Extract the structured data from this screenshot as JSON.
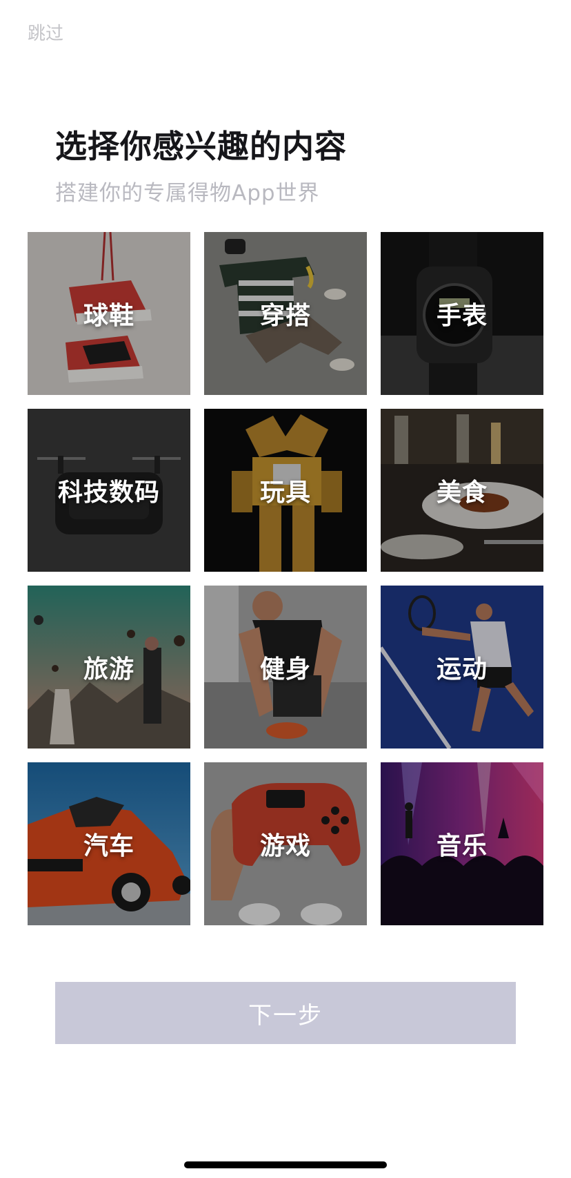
{
  "header": {
    "skip_label": "跳过",
    "title": "选择你感兴趣的内容",
    "subtitle": "搭建你的专属得物App世界"
  },
  "categories": [
    {
      "label": "球鞋",
      "icon": "sneakers-photo"
    },
    {
      "label": "穿搭",
      "icon": "outfit-photo"
    },
    {
      "label": "手表",
      "icon": "watch-photo"
    },
    {
      "label": "科技数码",
      "icon": "drone-photo"
    },
    {
      "label": "玩具",
      "icon": "mecha-figure-photo"
    },
    {
      "label": "美食",
      "icon": "dinner-plate-photo"
    },
    {
      "label": "旅游",
      "icon": "balloon-travel-photo"
    },
    {
      "label": "健身",
      "icon": "athlete-lacing-shoes-photo"
    },
    {
      "label": "运动",
      "icon": "tennis-player-photo"
    },
    {
      "label": "汽车",
      "icon": "sports-car-photo"
    },
    {
      "label": "游戏",
      "icon": "game-controller-photo"
    },
    {
      "label": "音乐",
      "icon": "concert-crowd-photo"
    }
  ],
  "footer": {
    "next_label": "下一步",
    "next_button_color": "#c8c8d8"
  }
}
